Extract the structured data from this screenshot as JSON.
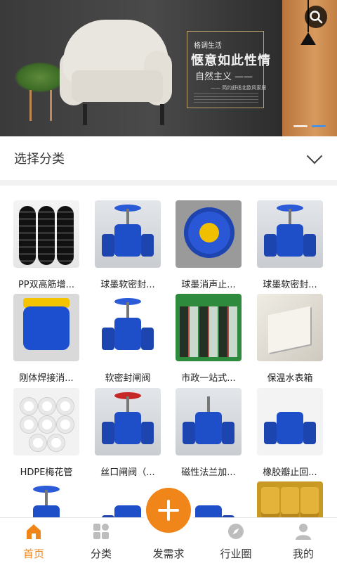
{
  "banner": {
    "small_text": "格调生活",
    "headline": "惬意如此性情",
    "subline": "自然主义 ——",
    "tiny_text": "—— 简约舒适北欧风家居",
    "active_slide": 2,
    "slide_count": 2
  },
  "category_bar": {
    "title": "选择分类"
  },
  "products": [
    {
      "label": "PP双高筋增..."
    },
    {
      "label": "球墨软密封..."
    },
    {
      "label": "球墨消声止..."
    },
    {
      "label": "球墨软密封..."
    },
    {
      "label": "刚体焊接消..."
    },
    {
      "label": "软密封闸阀"
    },
    {
      "label": "市政一站式..."
    },
    {
      "label": "保温水表箱"
    },
    {
      "label": "HDPE梅花管"
    },
    {
      "label": "丝口闸阀（..."
    },
    {
      "label": "磁性法兰加..."
    },
    {
      "label": "橡胶瓣止回..."
    },
    {
      "label": ""
    },
    {
      "label": ""
    },
    {
      "label": ""
    },
    {
      "label": ""
    }
  ],
  "nav": {
    "items": [
      {
        "label": "首页",
        "icon": "home-icon"
      },
      {
        "label": "分类",
        "icon": "category-icon"
      },
      {
        "label": "发需求",
        "icon": "plus-icon"
      },
      {
        "label": "行业圈",
        "icon": "compass-icon"
      },
      {
        "label": "我的",
        "icon": "user-icon"
      }
    ],
    "active": 0,
    "accent_color": "#f08519"
  }
}
